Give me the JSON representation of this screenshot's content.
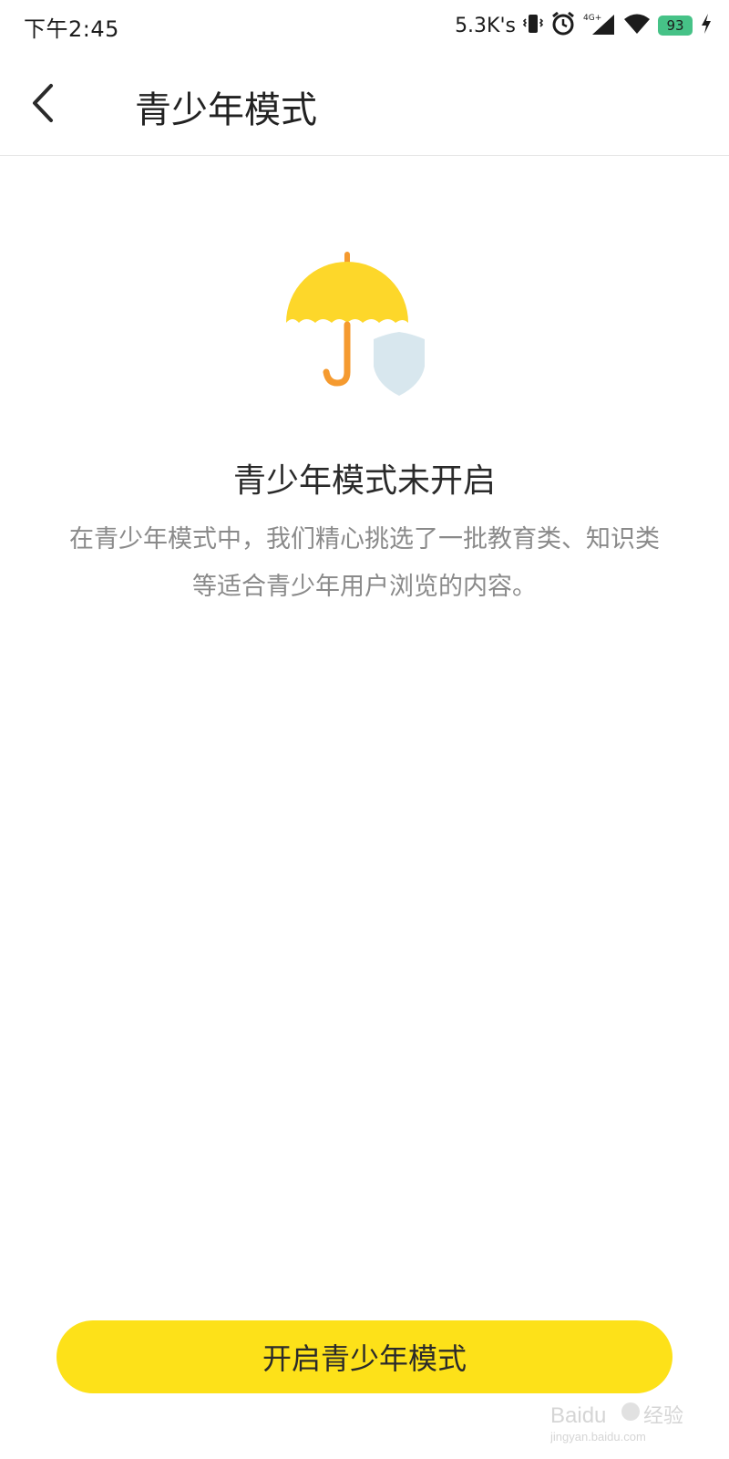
{
  "status_bar": {
    "time": "下午2:45",
    "net_speed": "5.3K's",
    "signal_label": "4G+",
    "battery": "93",
    "battery_color": "#46c287"
  },
  "nav": {
    "title": "青少年模式",
    "back_icon": "chevron-left-icon"
  },
  "main": {
    "illustration": "umbrella-shield-icon",
    "heading": "青少年模式未开启",
    "description": "在青少年模式中，我们精心挑选了一批教育类、知识类等适合青少年用户浏览的内容。"
  },
  "footer": {
    "enable_label": "开启青少年模式",
    "button_color": "#fde119"
  },
  "watermark": {
    "brand": "Baidu",
    "cn": "经验",
    "url": "jingyan.baidu.com"
  }
}
